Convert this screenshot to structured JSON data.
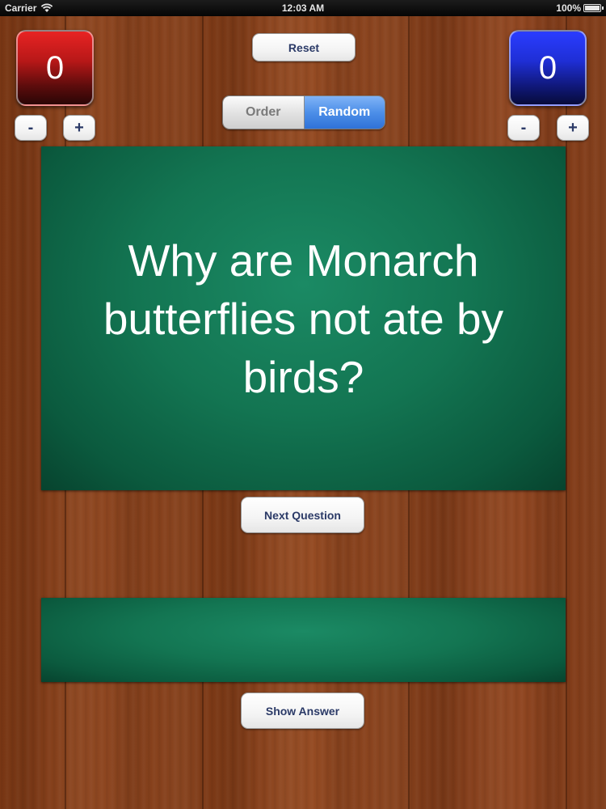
{
  "status_bar": {
    "carrier": "Carrier",
    "time": "12:03 AM",
    "battery": "100%",
    "battery_level": 1.0,
    "icons": {
      "signal": "wifi-icon",
      "battery": "battery-icon"
    }
  },
  "scoreboard": {
    "left": {
      "score": "0",
      "minus": "-",
      "plus": "+",
      "color": "#d01c1c"
    },
    "right": {
      "score": "0",
      "minus": "-",
      "plus": "+",
      "color": "#1f2fd6"
    }
  },
  "toolbar": {
    "reset_label": "Reset",
    "mode_options": [
      "Order",
      "Random"
    ],
    "mode_selected": "Random",
    "accent_color": "#4d8fe8"
  },
  "question": {
    "text": "Why are Monarch butterflies not ate by birds?",
    "next_label": "Next Question"
  },
  "answer": {
    "text": "",
    "show_label": "Show Answer"
  }
}
